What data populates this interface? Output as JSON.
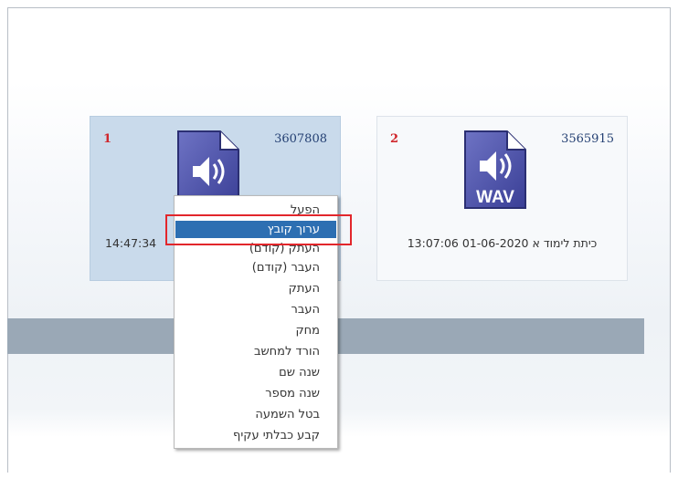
{
  "tiles": [
    {
      "index": "1",
      "id": "3607808",
      "caption_visible": "14:47:34",
      "selected": true,
      "icon": "audio-file-icon"
    },
    {
      "index": "2",
      "id": "3565915",
      "caption": "כיתת לימוד א 01-06-2020 13:07:06",
      "file_type": "WAV",
      "selected": false,
      "icon": "wav-file-icon"
    }
  ],
  "context_menu": {
    "items": [
      {
        "label": "הפעל"
      },
      {
        "label": "ערוך קובץ",
        "highlighted": true
      },
      {
        "label": "העתק (קודם)"
      },
      {
        "label": "העבר (קודם)"
      },
      {
        "label": "העתק"
      },
      {
        "label": "העבר"
      },
      {
        "label": "מחק"
      },
      {
        "label": "הורד למחשב"
      },
      {
        "label": "שנה שם"
      },
      {
        "label": "שנה מספר"
      },
      {
        "label": "בטל השמעה"
      },
      {
        "label": "קבע כבלתי עקיף"
      }
    ]
  },
  "colors": {
    "highlight": "#2d6fb2",
    "annotation_border": "#e2262b",
    "index_text": "#d0262b",
    "id_text": "#233f72",
    "selected_tile": "#c9daeb",
    "band": "#9aa8b6"
  }
}
